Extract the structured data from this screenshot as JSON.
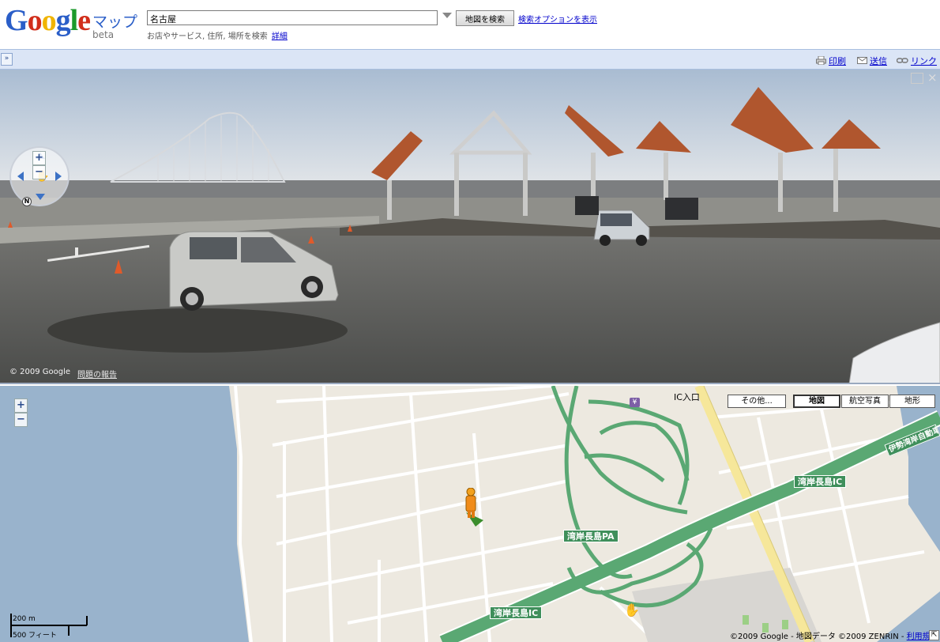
{
  "header": {
    "logo": [
      "G",
      "o",
      "o",
      "g",
      "l",
      "e"
    ],
    "maps_word": "マップ",
    "beta": "beta",
    "search_value": "名古屋",
    "search_button": "地図を検索",
    "options_link": "検索オプションを表示",
    "hint": "お店やサービス, 住所, 場所を検索",
    "hint_link": "詳細"
  },
  "toolbar": {
    "collapse": "»",
    "print": "印刷",
    "send": "送信",
    "link": "リンク"
  },
  "streetview": {
    "copyright": "© 2009 Google",
    "report": "問題の報告",
    "compass": "N",
    "close": "×"
  },
  "map": {
    "types": [
      "その他...",
      "地図",
      "航空写真",
      "地形"
    ],
    "selected_type": "地図",
    "road_labels": {
      "ic_top": "湾岸長島IC",
      "pa": "湾岸長島PA",
      "ic_bottom": "湾岸長島IC",
      "expressway": "伊勢湾岸自動車"
    },
    "ic_entrance": "IC入口",
    "yen": "¥",
    "scale_metric": "200 m",
    "scale_imperial": "500 フィート",
    "copyright": "©2009 Google - 地図データ ©2009 ZENRIN - ",
    "terms": "利用規約"
  },
  "colors": {
    "expressway": "#5aa873",
    "water": "#99b3cc",
    "land": "#ede9e0",
    "local_road": "#ffffff",
    "arterial": "#f6e79a",
    "toolbar": "#dbe5f6"
  }
}
